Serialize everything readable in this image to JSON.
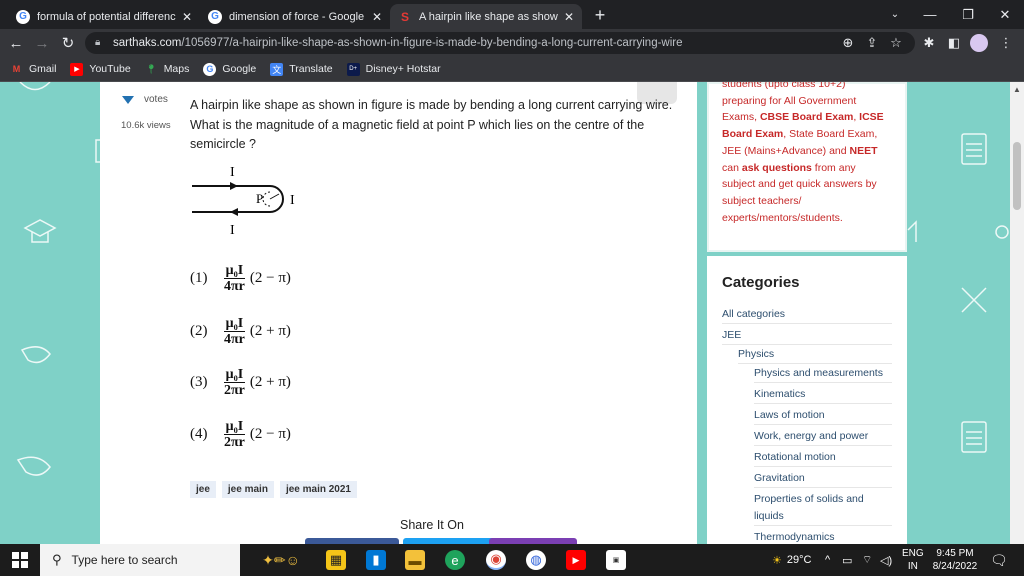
{
  "browser": {
    "tabs": [
      {
        "title": "formula of potential difference -",
        "favicon": "G"
      },
      {
        "title": "dimension of force - Google Sea",
        "favicon": "G"
      },
      {
        "title": "A hairpin like shape as shown in",
        "favicon": "S"
      }
    ],
    "url_host": "sarthaks.com",
    "url_path": "/1056977/a-hairpin-like-shape-as-shown-in-figure-is-made-by-bending-a-long-current-carrying-wire",
    "bookmarks": [
      "Gmail",
      "YouTube",
      "Maps",
      "Google",
      "Translate",
      "Disney+ Hotstar"
    ]
  },
  "question": {
    "votes_label": "votes",
    "views": "10.6k views",
    "text": "A hairpin like shape as shown in figure is made by bending a long current carrying wire. What is the magnitude of a magnetic field at point P which lies on the centre of the semicircle ?",
    "figure": {
      "label_top": "I",
      "label_bottom": "I",
      "label_right": "I",
      "label_p": "P"
    },
    "options": [
      {
        "num": "(1)",
        "numerator": "μ₀I",
        "denominator": "4πr",
        "tail": "(2 − π)"
      },
      {
        "num": "(2)",
        "numerator": "μ₀I",
        "denominator": "4πr",
        "tail": "(2 + π)"
      },
      {
        "num": "(3)",
        "numerator": "μ₀I",
        "denominator": "2πr",
        "tail": "(2 + π)"
      },
      {
        "num": "(4)",
        "numerator": "μ₀I",
        "denominator": "2πr",
        "tail": "(2 − π)"
      }
    ],
    "tags": [
      "jee",
      "jee main",
      "jee main 2021"
    ],
    "share_label": "Share It On"
  },
  "sidebar": {
    "promo_top": "students (upto class 10+2)",
    "promo_lines": [
      {
        "text": "preparing for All Government",
        "bold": false
      },
      {
        "text": "Exams, ",
        "bold": false,
        "bold_tail": "CBSE Board Exam"
      },
      {
        "text": ", ",
        "bold": false,
        "bold_tail": "ICSE"
      }
    ],
    "promo_html_parts": {
      "l1": "preparing for All Government",
      "l2a": "Exams, ",
      "l2b": "CBSE Board Exam",
      "l2c": ", ",
      "l2d": "ICSE",
      "l3a": "Board Exam",
      "l3b": ", State Board Exam,",
      "l4": "JEE (Mains+Advance) and ",
      "l4b": "NEET",
      "l5a": "can ",
      "l5b": "ask questions",
      "l5c": " from any",
      "l6": "subject and get quick answers by",
      "l7": "subject teachers/",
      "l8": "experts/mentors/students."
    },
    "categories_title": "Categories",
    "categories": [
      {
        "label": "All categories",
        "level": 0
      },
      {
        "label": "JEE",
        "level": 0
      },
      {
        "label": "Physics",
        "level": 1
      },
      {
        "label": "Physics and measurements",
        "level": 2
      },
      {
        "label": "Kinematics",
        "level": 2
      },
      {
        "label": "Laws of motion",
        "level": 2
      },
      {
        "label": "Work, energy and power",
        "level": 2
      },
      {
        "label": "Rotational motion",
        "level": 2
      },
      {
        "label": "Gravitation",
        "level": 2
      },
      {
        "label": "Properties of solids and",
        "level": 2
      },
      {
        "label": "liquids",
        "level": 2
      },
      {
        "label": "Thermodynamics",
        "level": 2
      }
    ]
  },
  "taskbar": {
    "search_placeholder": "Type here to search",
    "temperature": "29°C",
    "language": "ENG",
    "region": "IN",
    "time": "9:45 PM",
    "date": "8/24/2022"
  },
  "colors": {
    "accent": "#2271b1",
    "sidebar_text": "#c62828",
    "page_bg": "#7fd1c7"
  }
}
